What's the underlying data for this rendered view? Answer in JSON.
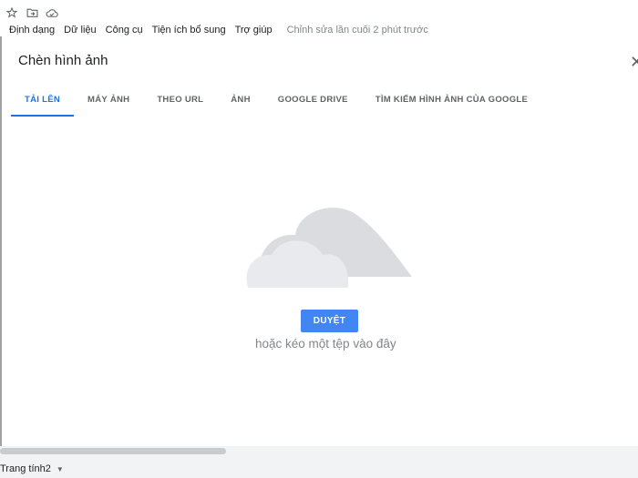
{
  "toolbar": {
    "icons": [
      "star-icon",
      "folder-move-icon",
      "cloud-saved-icon"
    ]
  },
  "menu": {
    "items": [
      "Định dạng",
      "Dữ liệu",
      "Công cụ",
      "Tiện ích bổ sung",
      "Trợ giúp"
    ],
    "status": "Chỉnh sửa lần cuối 2 phút trước"
  },
  "dialog": {
    "title": "Chèn hình ảnh",
    "tabs": [
      {
        "label": "TẢI LÊN",
        "active": true
      },
      {
        "label": "MÁY ẢNH",
        "active": false
      },
      {
        "label": "THEO URL",
        "active": false
      },
      {
        "label": "ẢNH",
        "active": false
      },
      {
        "label": "GOOGLE DRIVE",
        "active": false
      },
      {
        "label": "TÌM KIẾM HÌNH ẢNH CỦA GOOGLE",
        "active": false
      }
    ],
    "browse_label": "DUYỆT",
    "drag_hint": "hoặc kéo một tệp vào đây"
  },
  "sheet": {
    "tab_label": "Trang tính2"
  },
  "colors": {
    "accent": "#1a73e8",
    "button": "#4285f4",
    "cloud_back": "#dadce0",
    "cloud_front": "#e8eaed"
  }
}
